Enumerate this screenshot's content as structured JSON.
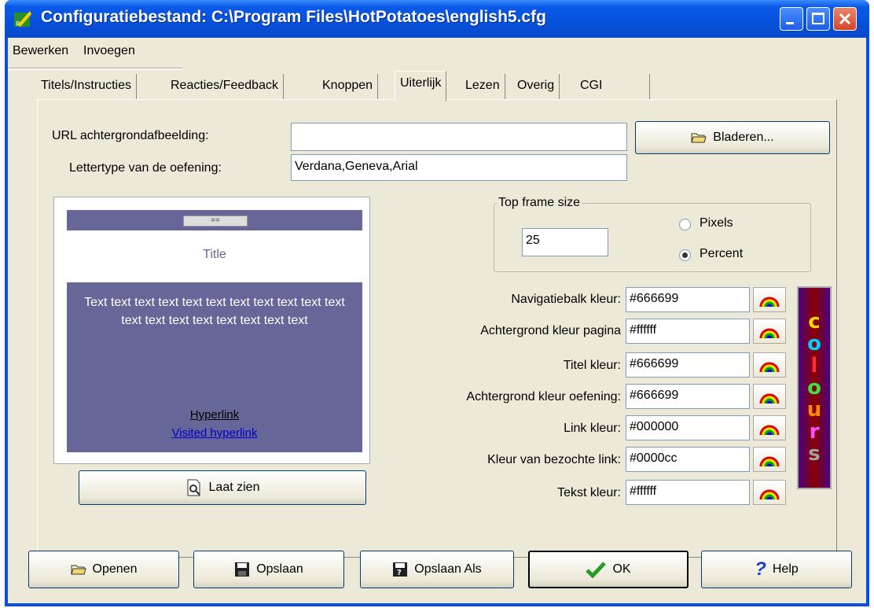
{
  "window": {
    "title": "Configuratiebestand: C:\\Program Files\\HotPotatoes\\english5.cfg"
  },
  "menu": {
    "items": [
      "Bewerken",
      "Invoegen"
    ]
  },
  "tabs": [
    "Titels/Instructies",
    "Reacties/Feedback",
    "Knoppen",
    "Uiterlijk",
    "Lezen",
    "Overig",
    "CGI"
  ],
  "active_tab": "Uiterlijk",
  "form": {
    "bg_url_label": "URL achtergrondafbeelding:",
    "bg_url_value": "",
    "font_label": "Lettertype van de oefening:",
    "font_value": "Verdana,Geneva,Arial",
    "browse_label": "Bladeren..."
  },
  "preview": {
    "nav_button": "==",
    "title": "Title",
    "text": "Text text text text text text text text text text text text text text text text text text text",
    "link": "Hyperlink",
    "visited_link": "Visited hyperlink",
    "show_button": "Laat zien"
  },
  "top_frame": {
    "legend": "Top frame size",
    "value": "25",
    "pixels_label": "Pixels",
    "percent_label": "Percent",
    "selected": "Percent"
  },
  "colors": [
    {
      "label": "Navigatiebalk kleur:",
      "value": "#666699"
    },
    {
      "label": "Achtergrond kleur pagina",
      "value": "#ffffff"
    },
    {
      "label": "Titel kleur:",
      "value": "#666699"
    },
    {
      "label": "Achtergrond kleur oefening:",
      "value": "#666699"
    },
    {
      "label": "Link kleur:",
      "value": "#000000"
    },
    {
      "label": "Kleur van bezochte link:",
      "value": "#0000cc"
    },
    {
      "label": "Tekst kleur:",
      "value": "#ffffff"
    }
  ],
  "colours_logo": [
    "c",
    "o",
    "l",
    "o",
    "u",
    "r",
    "s"
  ],
  "buttons": {
    "open": "Openen",
    "save": "Opslaan",
    "save_as": "Opslaan Als",
    "ok": "OK",
    "help": "Help"
  }
}
